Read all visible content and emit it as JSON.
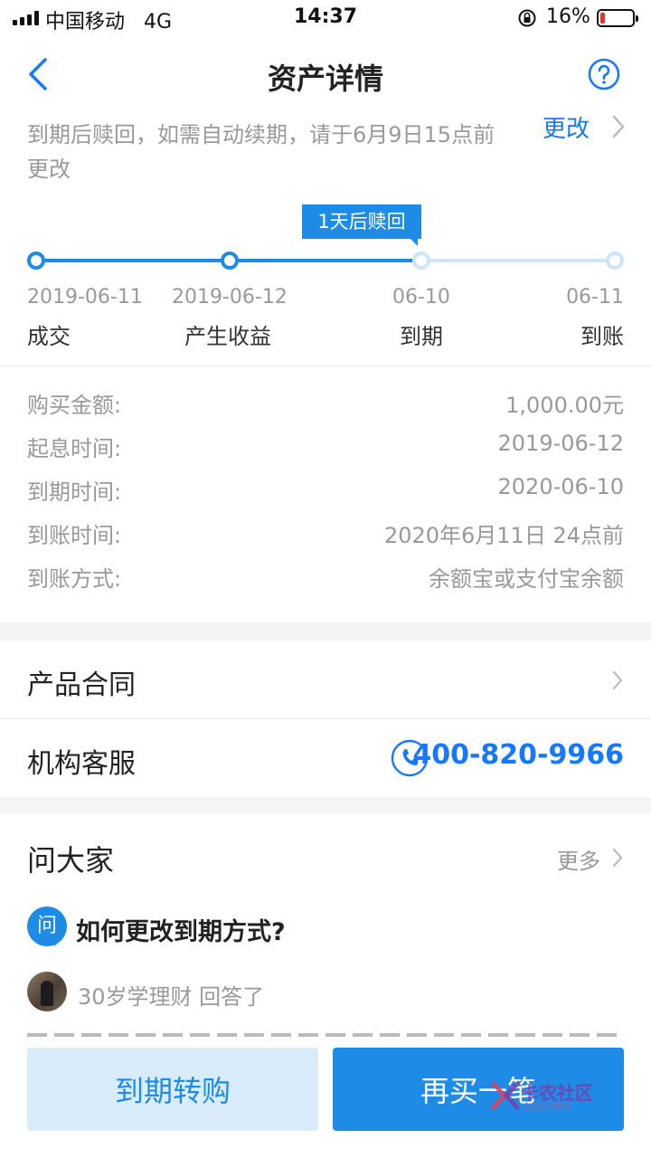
{
  "status_bar": {
    "carrier": "中国移动",
    "network": "4G",
    "time": "14:37",
    "battery_percent": "16%",
    "battery_level": 0.16,
    "battery_color": "#e8332d"
  },
  "nav": {
    "title": "资产详情",
    "back_icon": "chevron-left-icon",
    "help_icon": "question-circle-icon"
  },
  "notice": {
    "text": "到期后赎回，如需自动续期，请于6月9日15点前更改",
    "change_label": "更改"
  },
  "timeline": {
    "tooltip": "1天后赎回",
    "progress_stage": 2,
    "steps": [
      {
        "date": "2019-06-11",
        "label": "成交",
        "done": true
      },
      {
        "date": "2019-06-12",
        "label": "产生收益",
        "done": true
      },
      {
        "date": "06-10",
        "label": "到期",
        "done": false
      },
      {
        "date": "06-11",
        "label": "到账",
        "done": false
      }
    ]
  },
  "details": [
    {
      "key": "购买金额:",
      "value": "1,000.00元"
    },
    {
      "key": "起息时间:",
      "value": "2019-06-12"
    },
    {
      "key": "到期时间:",
      "value": "2020-06-10"
    },
    {
      "key": "到账时间:",
      "value": "2020年6月11日 24点前"
    },
    {
      "key": "到账方式:",
      "value": "余额宝或支付宝余额"
    }
  ],
  "contract": {
    "label": "产品合同"
  },
  "service": {
    "label": "机构客服",
    "phone": "400-820-9966",
    "icon": "phone-icon"
  },
  "qa": {
    "title": "问大家",
    "more": "更多",
    "badge": "问",
    "question": "如何更改到期方式?",
    "answerer": "30岁学理财 回答了"
  },
  "buttons": {
    "renew": "到期转购",
    "rebuy": "再买一笔"
  },
  "watermark": {
    "text": "卡农社区",
    "sub": "金融在线教育"
  },
  "colors": {
    "accent": "#1e8be6",
    "link": "#1677ff",
    "pending": "#cfe4f7"
  }
}
